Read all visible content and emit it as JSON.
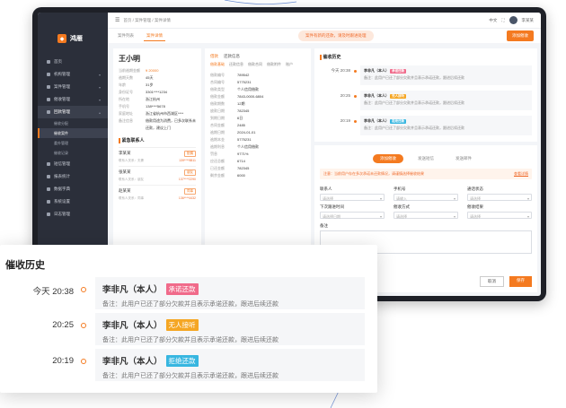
{
  "app": {
    "name": "鸿雁",
    "breadcrumb": "首页 / 案件管理 / 案件详情",
    "topbar_items": [
      "中文",
      "退出"
    ],
    "user_name": "李某某"
  },
  "sidebar": {
    "items": [
      {
        "label": "首页"
      },
      {
        "label": "机构管理"
      },
      {
        "label": "案件管理"
      },
      {
        "label": "催收管理"
      },
      {
        "label": "回款管理"
      }
    ],
    "sub_items": [
      "催收分配",
      "催收案件",
      "委外管理",
      "催收记录"
    ],
    "items_below": [
      {
        "label": "短信管理"
      },
      {
        "label": "报表统计"
      },
      {
        "label": "数据字典"
      },
      {
        "label": "系统设置"
      },
      {
        "label": "日志管理"
      }
    ]
  },
  "tabbar": {
    "tabs": [
      "案件列表",
      "案件详情"
    ],
    "notice": "案件有新的还款，请及时跟进处理",
    "action": "添加催收"
  },
  "debtor": {
    "name": "王小明",
    "fields": [
      {
        "k": "当前逾期金额",
        "v": "¥ 20000",
        "orange": true
      },
      {
        "k": "逾期天数",
        "v": "45天"
      },
      {
        "k": "年龄",
        "v": "31岁"
      },
      {
        "k": "身份证号",
        "v": "3301****1234"
      },
      {
        "k": "所在地",
        "v": "浙江杭州"
      },
      {
        "k": "手机号",
        "v": "138****5678"
      },
      {
        "k": "家庭地址",
        "v": "浙江省杭州市西湖区****"
      },
      {
        "k": "备注信息",
        "v": "借款用途为消费，已多次联系未还款，建议上门"
      }
    ]
  },
  "contacts": {
    "title": "紧急联系人",
    "items": [
      {
        "name": "李某某",
        "tag": "配偶",
        "relation": "联系人关系：夫妻",
        "phone": "139****8811"
      },
      {
        "name": "张某某",
        "tag": "朋友",
        "relation": "联系人关系：朋友",
        "phone": "137****2290"
      },
      {
        "name": "赵某某",
        "tag": "同事",
        "relation": "联系人关系：同事",
        "phone": "136****4432"
      }
    ]
  },
  "mid": {
    "tabs": [
      "借款",
      "还款信息"
    ],
    "subtabs": [
      "借款基础",
      "还款信息",
      "借款合同",
      "借款附件",
      "账户"
    ],
    "fields": [
      {
        "k": "借款编号",
        "v": "789542"
      },
      {
        "k": "合同编号",
        "v": "5775231"
      },
      {
        "k": "借款类型",
        "v": "个人信用借款"
      },
      {
        "k": "借款金额",
        "v": "7843-0000-6804"
      },
      {
        "k": "借款期数",
        "v": "12期"
      },
      {
        "k": "放款日期",
        "v": "782345"
      },
      {
        "k": "到期日期",
        "v": "6日"
      },
      {
        "k": "合同金额",
        "v": "2485"
      },
      {
        "k": "逾期日期",
        "v": "2024-01-01"
      },
      {
        "k": "逾期本金",
        "v": "5775231"
      },
      {
        "k": "逾期利息",
        "v": "个人信用借款"
      },
      {
        "k": "罚息",
        "v": "9771%"
      },
      {
        "k": "应还总额",
        "v": "6714"
      },
      {
        "k": "已还金额",
        "v": "782345"
      },
      {
        "k": "剩余金额",
        "v": "6000"
      }
    ]
  },
  "history": {
    "title": "催收历史",
    "entries": [
      {
        "time": "今天 20:38",
        "who": "李非凡（本人）",
        "badge": "承诺还款",
        "badge_color": "#f06a8a",
        "note": "备注：此用户已还了部分欠款并且表示承诺还款，跟进后续还款"
      },
      {
        "time": "20:25",
        "who": "李非凡（本人）",
        "badge": "无人接听",
        "badge_color": "#f5a623",
        "note": "备注：此用户已还了部分欠款并且表示承诺还款，跟进后续还款"
      },
      {
        "time": "20:19",
        "who": "李非凡（本人）",
        "badge": "拒绝还款",
        "badge_color": "#37b6e0",
        "note": "备注：此用户已还了部分欠款并且表示承诺还款，跟进后续还款"
      }
    ]
  },
  "form": {
    "segments": [
      "添加催收",
      "发送短信",
      "发送邮件"
    ],
    "warning": "注意：当前用户存在多次承诺未还款情况，请谨慎选择催收结果",
    "warning_link": "查看详情",
    "fields": [
      {
        "label": "联系人",
        "placeholder": "请选择"
      },
      {
        "label": "手机号",
        "placeholder": "请输入"
      },
      {
        "label": "通话状态",
        "placeholder": "请选择"
      },
      {
        "label": "下次跟进时间",
        "placeholder": "请选择日期"
      },
      {
        "label": "催收方式",
        "placeholder": "请选择"
      },
      {
        "label": "催收结果",
        "placeholder": "请选择"
      }
    ],
    "remark_label": "备注",
    "cancel": "取消",
    "submit": "保存"
  },
  "zoom": {
    "title": "催收历史",
    "entries": [
      {
        "time": "今天 20:38",
        "who": "李非凡（本人）",
        "badge": "承诺还款",
        "badge_color": "#f06a8a",
        "note": "备注：此用户已还了部分欠款并且表示承诺还款，跟进后续还款"
      },
      {
        "time": "20:25",
        "who": "李非凡（本人）",
        "badge": "无人接听",
        "badge_color": "#f5a623",
        "note": "备注：此用户已还了部分欠款并且表示承诺还款，跟进后续还款"
      },
      {
        "time": "20:19",
        "who": "李非凡（本人）",
        "badge": "拒绝还款",
        "badge_color": "#37b6e0",
        "note": "备注：此用户已还了部分欠款并且表示承诺还款，跟进后续还款"
      }
    ]
  }
}
